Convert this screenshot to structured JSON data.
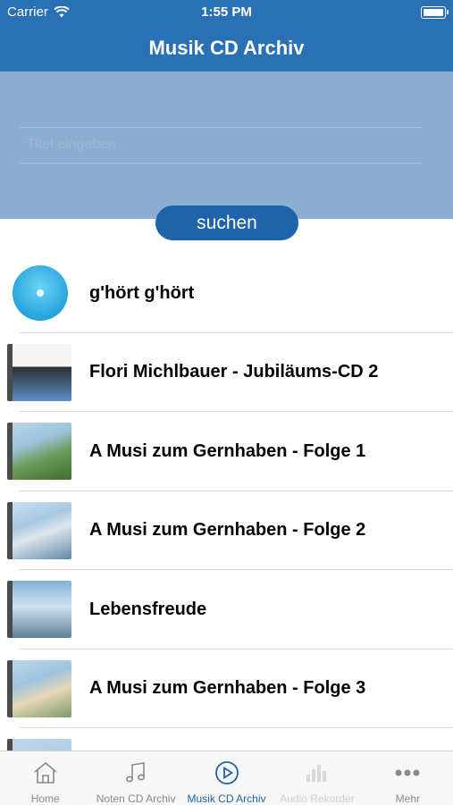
{
  "status": {
    "carrier": "Carrier",
    "time": "1:55 PM"
  },
  "navbar": {
    "title": "Musik CD Archiv"
  },
  "search": {
    "placeholder": "Titel eingeben",
    "button_label": "suchen"
  },
  "results": [
    {
      "title": "g'hört g'hört",
      "cover": "cd-disc"
    },
    {
      "title": "Flori Michlbauer - Jubiläums-CD 2",
      "cover": "album-cover"
    },
    {
      "title": "A Musi zum Gernhaben - Folge 1",
      "cover": "album-cover"
    },
    {
      "title": "A Musi zum Gernhaben - Folge 2",
      "cover": "album-cover"
    },
    {
      "title": "Lebensfreude",
      "cover": "album-cover"
    },
    {
      "title": "A Musi zum Gernhaben - Folge 3",
      "cover": "album-cover"
    }
  ],
  "tabbar": {
    "items": [
      {
        "label": "Home",
        "icon": "home-icon",
        "state": "normal"
      },
      {
        "label": "Noten CD Archiv",
        "icon": "music-notes-icon",
        "state": "normal"
      },
      {
        "label": "Musik CD Archiv",
        "icon": "play-circle-icon",
        "state": "active"
      },
      {
        "label": "Audio Rekorder",
        "icon": "equalizer-icon",
        "state": "disabled"
      },
      {
        "label": "Mehr",
        "icon": "more-icon",
        "state": "normal"
      }
    ]
  },
  "colors": {
    "accent": "#2a70b4",
    "search_panel": "#8caed3",
    "button": "#1f63a8"
  }
}
